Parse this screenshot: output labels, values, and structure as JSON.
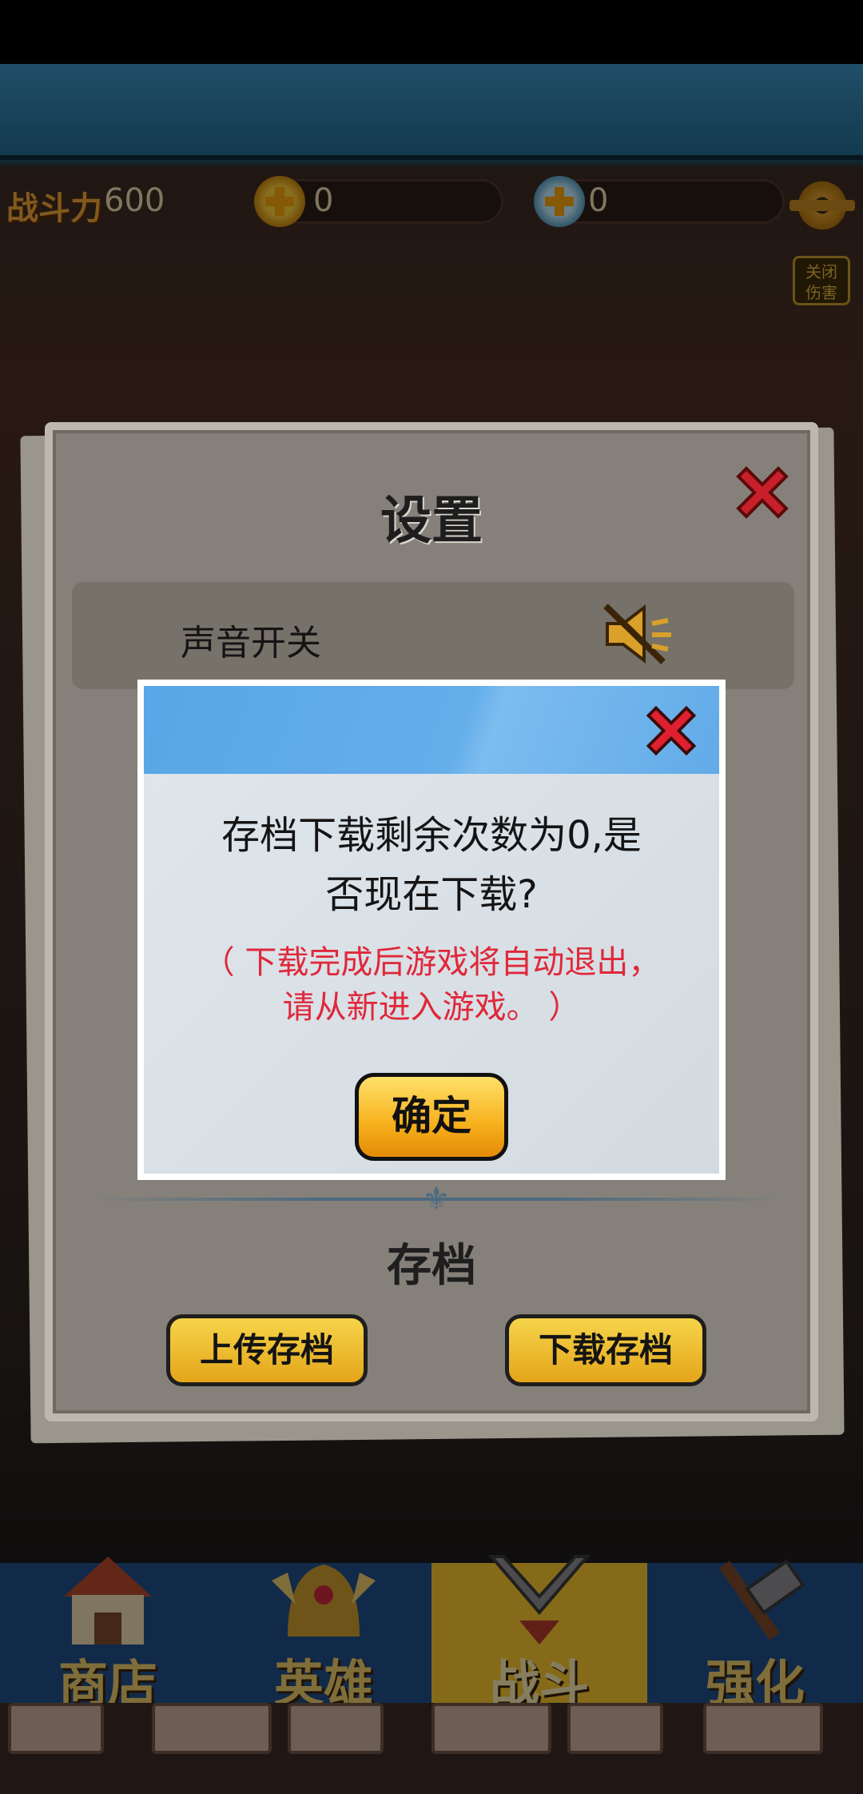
{
  "top_bar": {
    "power_label": "战斗力",
    "power_value": "600",
    "coin_value": "0",
    "gem_value": "0",
    "hide_label_line1": "关闭",
    "hide_label_line2": "伤害"
  },
  "settings_panel": {
    "title": "设置",
    "sound_label": "声音开关",
    "save_section_title": "存档",
    "upload_button": "上传存档",
    "download_button": "下载存档"
  },
  "dialog": {
    "message_line1": "存档下载剩余次数为0,是",
    "message_line2": "否现在下载?",
    "note_line1": "（ 下载完成后游戏将自动退出，",
    "note_line2": "请从新进入游戏。 ）",
    "confirm_button": "确定"
  },
  "bottom_nav": {
    "items": [
      {
        "label": "商店",
        "icon": "shop-icon"
      },
      {
        "label": "英雄",
        "icon": "hero-icon"
      },
      {
        "label": "战斗",
        "icon": "battle-icon"
      },
      {
        "label": "强化",
        "icon": "upgrade-icon"
      }
    ],
    "active_index": 2
  },
  "colors": {
    "dialog_header": "#5aa6e6",
    "note_text": "#e0283a",
    "button_yellow": "#f6b01c",
    "nav_blue": "#1f4d86",
    "nav_active": "#f0c22e"
  }
}
